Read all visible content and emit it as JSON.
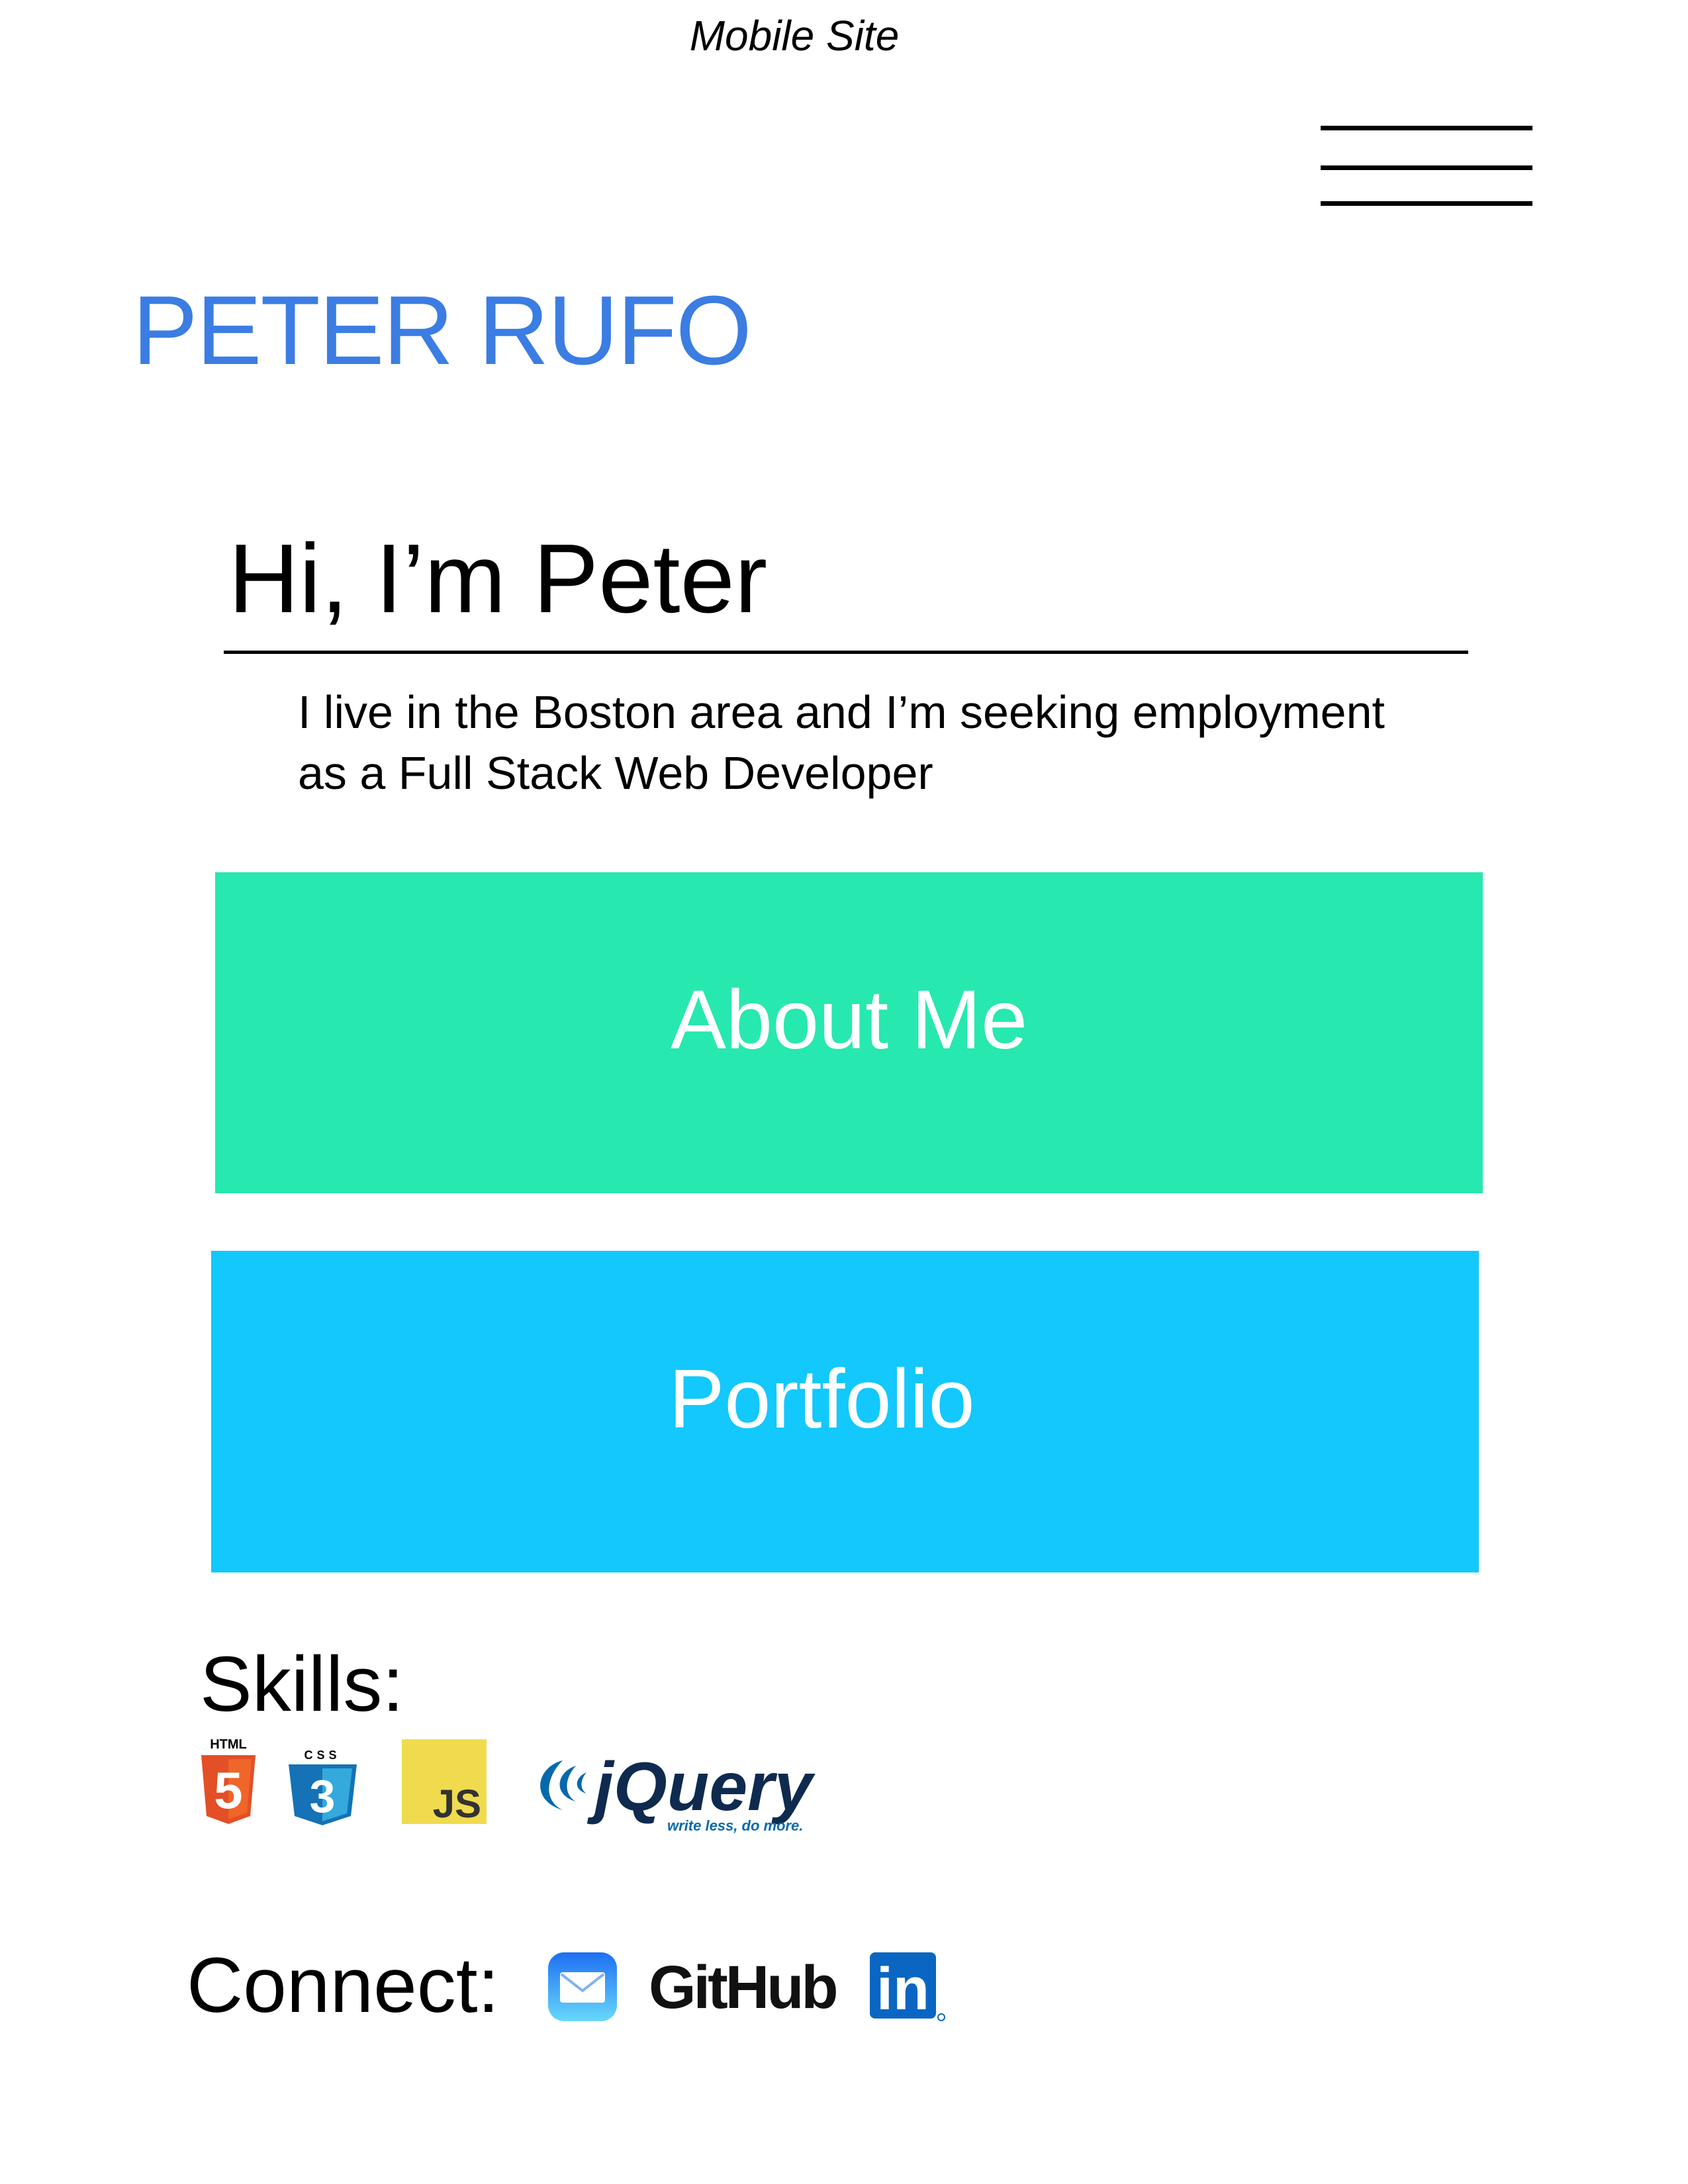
{
  "page": {
    "caption": "Mobile Site"
  },
  "header": {
    "site_title": "PETER RUFO",
    "menu_icon": "hamburger-menu-icon"
  },
  "hero": {
    "greeting": "Hi, I’m Peter",
    "intro_line_1": "I live in the Boston area and I’m seeking employment",
    "intro_line_2": "as a Full Stack Web Developer"
  },
  "buttons": {
    "about_label": "About Me",
    "portfolio_label": "Portfolio"
  },
  "skills": {
    "heading": "Skills:",
    "html_label": "HTML",
    "html_glyph": "5",
    "css_label": "CSS",
    "css_glyph": "3",
    "js_label": "JS",
    "jquery_label": "jQuery",
    "jquery_tagline": "write less, do more."
  },
  "connect": {
    "heading": "Connect:",
    "mail_icon": "mail-icon",
    "github_label": "GitHub",
    "linkedin_label": "in"
  },
  "colors": {
    "title_blue": "#3b7de2",
    "about_green": "#27e8af",
    "portfolio_blue": "#12c8fc",
    "html_orange": "#e34f26",
    "css_blue": "#1572b6",
    "js_yellow": "#f0db4f",
    "jquery_navy": "#0f2a4f",
    "linkedin_blue": "#0a66c2"
  }
}
